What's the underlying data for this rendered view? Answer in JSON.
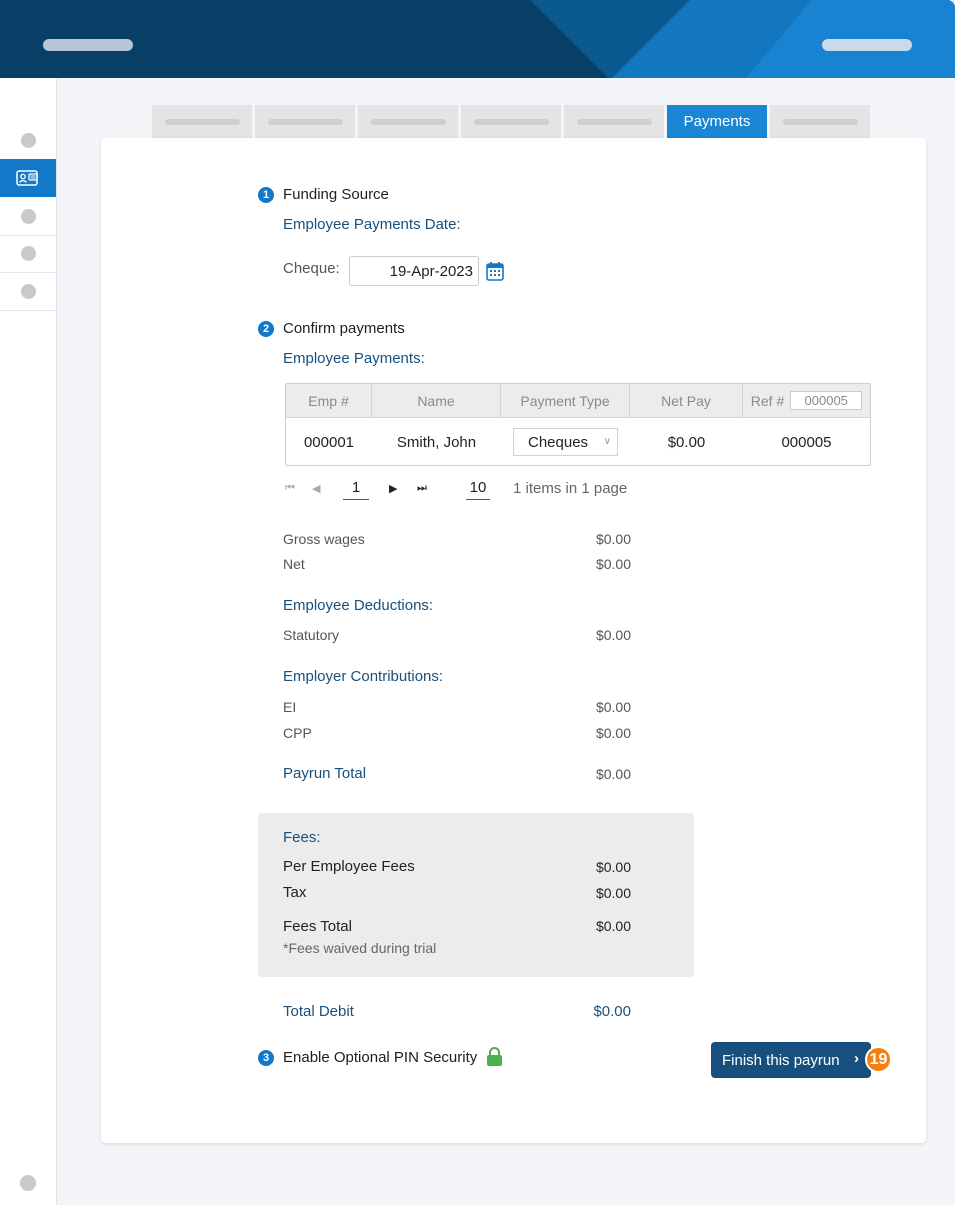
{
  "tabs": {
    "active_label": "Payments"
  },
  "step1": {
    "number": "1",
    "title": "Funding Source",
    "subheading": "Employee Payments Date:",
    "cheque_label": "Cheque:",
    "cheque_date": "19-Apr-2023"
  },
  "step2": {
    "number": "2",
    "title": "Confirm payments",
    "subheading": "Employee Payments:"
  },
  "table": {
    "headers": {
      "emp": "Emp #",
      "name": "Name",
      "payment_type": "Payment Type",
      "net_pay": "Net Pay",
      "ref": "Ref #"
    },
    "ref_input_value": "000005",
    "rows": [
      {
        "emp": "000001",
        "name": "Smith, John",
        "payment_type": "Cheques",
        "net_pay": "$0.00",
        "ref": "000005"
      }
    ]
  },
  "pager": {
    "page": "1",
    "page_size": "10",
    "summary": "1 items in 1 page"
  },
  "summary": {
    "gross_wages_label": "Gross wages",
    "gross_wages": "$0.00",
    "net_label": "Net",
    "net": "$0.00",
    "deductions_heading": "Employee Deductions:",
    "statutory_label": "Statutory",
    "statutory": "$0.00",
    "contributions_heading": "Employer Contributions:",
    "ei_label": "EI",
    "ei": "$0.00",
    "cpp_label": "CPP",
    "cpp": "$0.00",
    "payrun_total_label": "Payrun Total",
    "payrun_total": "$0.00"
  },
  "fees": {
    "heading": "Fees:",
    "per_employee_label": "Per Employee Fees",
    "per_employee": "$0.00",
    "tax_label": "Tax",
    "tax": "$0.00",
    "total_label": "Fees Total",
    "total": "$0.00",
    "note": "*Fees waived during trial"
  },
  "total_debit": {
    "label": "Total Debit",
    "value": "$0.00"
  },
  "step3": {
    "number": "3",
    "title": "Enable Optional PIN Security"
  },
  "finish_button": {
    "label": "Finish this payrun",
    "badge": "19"
  },
  "colors": {
    "brand_dark": "#17507e",
    "brand_blue": "#1378c7",
    "lock_green": "#4caf50",
    "badge_orange": "#f57e12"
  }
}
